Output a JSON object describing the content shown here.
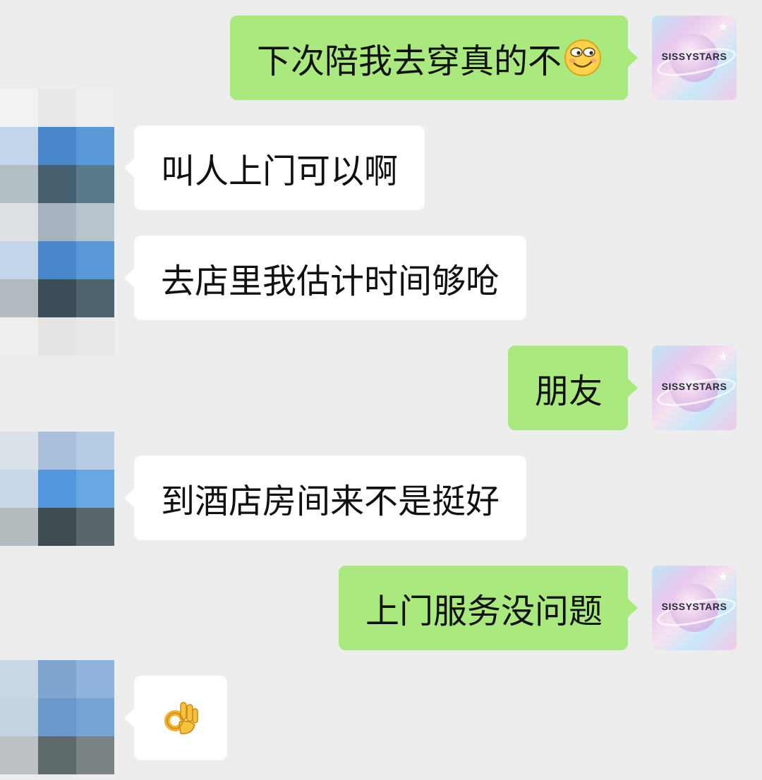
{
  "messages": [
    {
      "side": "sent",
      "text": "下次陪我去穿真的不",
      "emoji": "smirk-emoji"
    },
    {
      "side": "recv",
      "text": "叫人上门可以啊"
    },
    {
      "side": "recv",
      "text": "去店里我估计时间够呛"
    },
    {
      "side": "sent",
      "text": "朋友"
    },
    {
      "side": "recv",
      "text": "到酒店房间来不是挺好"
    },
    {
      "side": "sent",
      "text": "上门服务没问题"
    },
    {
      "side": "recv",
      "text": "",
      "emoji": "ok-hand-emoji"
    }
  ],
  "self_avatar": {
    "label": "SISSYSTARS",
    "icon": "planet-logo-icon"
  },
  "colors": {
    "background": "#ededed",
    "sent_bubble": "#a9e97e",
    "received_bubble": "#ffffff"
  }
}
